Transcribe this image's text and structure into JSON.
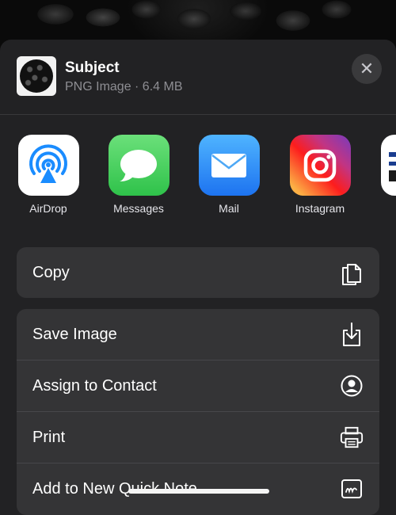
{
  "share_sheet": {
    "title": "Subject",
    "subtitle": "PNG Image · 6.4 MB",
    "close_icon": "close-icon"
  },
  "apps": [
    {
      "label": "AirDrop",
      "icon": "airdrop-icon"
    },
    {
      "label": "Messages",
      "icon": "messages-icon"
    },
    {
      "label": "Mail",
      "icon": "mail-icon"
    },
    {
      "label": "Instagram",
      "icon": "instagram-icon"
    },
    {
      "label": "",
      "icon": "partial-app-icon"
    }
  ],
  "actions_primary": [
    {
      "label": "Copy",
      "icon": "copy-icon"
    }
  ],
  "actions_secondary": [
    {
      "label": "Save Image",
      "icon": "save-icon"
    },
    {
      "label": "Assign to Contact",
      "icon": "contact-icon"
    },
    {
      "label": "Print",
      "icon": "printer-icon"
    },
    {
      "label": "Add to New Quick Note",
      "icon": "quick-note-icon"
    }
  ],
  "colors": {
    "sheet_bg": "#222224",
    "row_bg": "#343436",
    "text_primary": "#ffffff",
    "text_secondary": "#8e8e93"
  }
}
